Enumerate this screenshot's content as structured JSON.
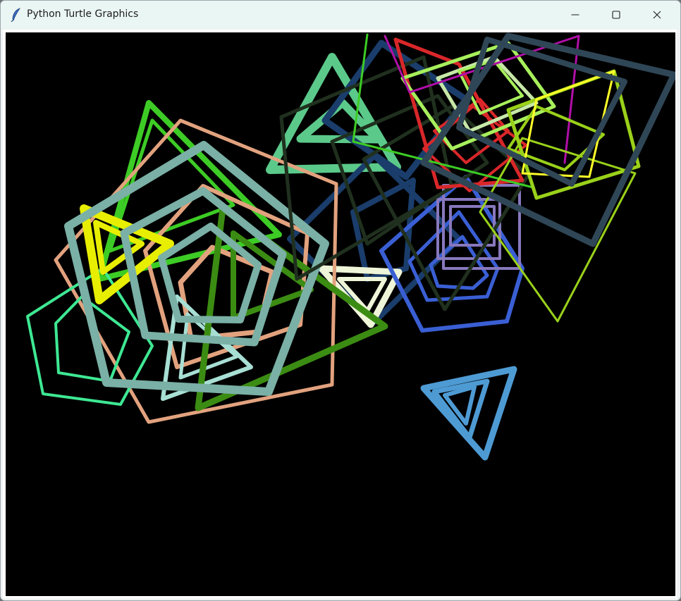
{
  "window": {
    "title": "Python Turtle Graphics",
    "icon": "feather-icon",
    "controls": [
      "minimize-icon",
      "maximize-icon",
      "close-icon"
    ]
  },
  "canvas": {
    "background": "#000000",
    "shape_colors": [
      "#5bc98a",
      "#e2a27e",
      "#7ab0a6",
      "#3dcc25",
      "#e8ee00",
      "#3ee893",
      "#3b8c12",
      "#a8dfd4",
      "#eef5d8",
      "#1a3d6b",
      "#20301e",
      "#3a5fd4",
      "#8878bd",
      "#4e9bd4",
      "#d9272a",
      "#a7f05c",
      "#2f4656",
      "#ffff2a",
      "#b00fa8",
      "#9ad11a",
      "#c7e8a8"
    ]
  }
}
